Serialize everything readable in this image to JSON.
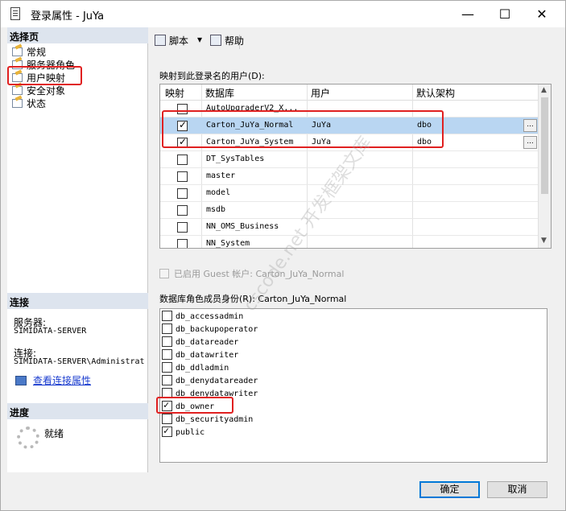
{
  "window": {
    "title": "登录属性 - JuYa",
    "minimize": "—",
    "maximize": "☐",
    "close": "✕"
  },
  "sidebar": {
    "select_page_header": "选择页",
    "items": [
      {
        "label": "常规"
      },
      {
        "label": "服务器角色"
      },
      {
        "label": "用户映射"
      },
      {
        "label": "安全对象"
      },
      {
        "label": "状态"
      }
    ],
    "connection_header": "连接",
    "server_label": "服务器:",
    "server_value": "SIMIDATA-SERVER",
    "connection_label": "连接:",
    "connection_value": "SIMIDATA-SERVER\\Administrat",
    "view_connection_link": "查看连接属性",
    "progress_header": "进度",
    "progress_status": "就绪"
  },
  "toolbar": {
    "script_label": "脚本",
    "help_label": "帮助"
  },
  "mapping": {
    "group_label": "映射到此登录名的用户(D):",
    "columns": [
      "映射",
      "数据库",
      "用户",
      "默认架构"
    ],
    "rows": [
      {
        "checked": false,
        "db": "AutoUpgraderV2_X...",
        "user": "",
        "schema": ""
      },
      {
        "checked": true,
        "db": "Carton_JuYa_Normal",
        "user": "JuYa",
        "schema": "dbo",
        "selected": true
      },
      {
        "checked": true,
        "db": "Carton_JuYa_System",
        "user": "JuYa",
        "schema": "dbo"
      },
      {
        "checked": false,
        "db": "DT_SysTables",
        "user": "",
        "schema": ""
      },
      {
        "checked": false,
        "db": "master",
        "user": "",
        "schema": ""
      },
      {
        "checked": false,
        "db": "model",
        "user": "",
        "schema": ""
      },
      {
        "checked": false,
        "db": "msdb",
        "user": "",
        "schema": ""
      },
      {
        "checked": false,
        "db": "NN_OMS_Business",
        "user": "",
        "schema": ""
      },
      {
        "checked": false,
        "db": "NN_System",
        "user": "",
        "schema": ""
      }
    ],
    "ellipsis": "..."
  },
  "guest": {
    "label": "已启用 Guest 帐户: Carton_JuYa_Normal"
  },
  "roles": {
    "group_label": "数据库角色成员身份(R): Carton_JuYa_Normal",
    "items": [
      {
        "name": "db_accessadmin",
        "checked": false
      },
      {
        "name": "db_backupoperator",
        "checked": false
      },
      {
        "name": "db_datareader",
        "checked": false
      },
      {
        "name": "db_datawriter",
        "checked": false
      },
      {
        "name": "db_ddladmin",
        "checked": false
      },
      {
        "name": "db_denydatareader",
        "checked": false
      },
      {
        "name": "db_denydatawriter",
        "checked": false
      },
      {
        "name": "db_owner",
        "checked": true
      },
      {
        "name": "db_securityadmin",
        "checked": false
      },
      {
        "name": "public",
        "checked": true
      }
    ]
  },
  "buttons": {
    "ok": "确定",
    "cancel": "取消"
  },
  "watermark": "cscode.net 开发框架文库",
  "colors": {
    "selected_row": "#b9d6f2",
    "highlight_box": "#e02020",
    "default_button_border": "#0078d7",
    "section_header": "#dde4ee"
  }
}
